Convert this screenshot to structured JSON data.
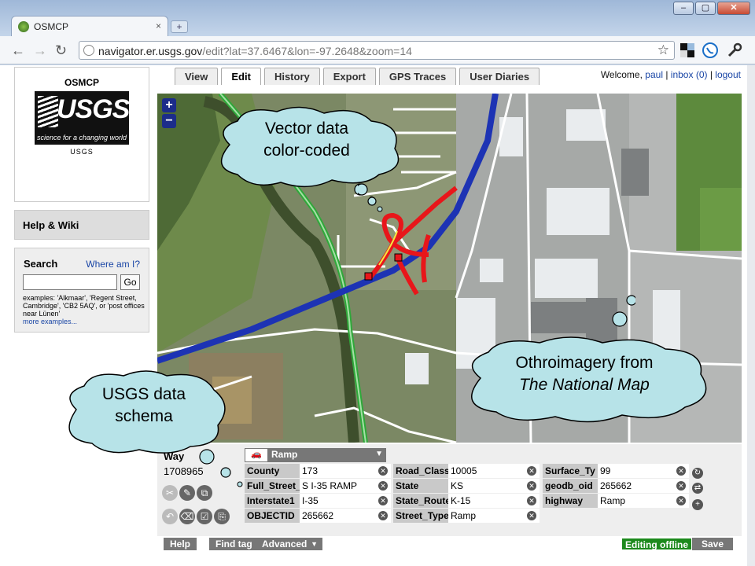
{
  "browser": {
    "tab_title": "OSMCP",
    "tab_close": "×",
    "new_tab": "+",
    "url_host": "navigator.er.usgs.gov",
    "url_path": "/edit?lat=37.6467&lon=-97.2648&zoom=14",
    "back": "←",
    "forward": "→",
    "reload": "↻",
    "star": "☆",
    "window_buttons": [
      "–",
      "▢",
      "✕"
    ]
  },
  "sidebar": {
    "site_name": "OSMCP",
    "logo_text": "USGS",
    "logo_tagline": "science for a changing world",
    "logo_caption": "USGS",
    "help_label": "Help & Wiki",
    "search_label": "Search",
    "where_label": "Where am I?",
    "search_value": "",
    "go_label": "Go",
    "examples_text": "examples: 'Alkmaar', 'Regent Street, Cambridge', 'CB2 5AQ', or 'post offices near Lünen'",
    "more_examples": "more examples..."
  },
  "nav_tabs": [
    "View",
    "Edit",
    "History",
    "Export",
    "GPS Traces",
    "User Diaries"
  ],
  "active_tab": "Edit",
  "header": {
    "welcome": "Welcome,",
    "inbox": "inbox (0)",
    "sep": "|",
    "logout": "logout"
  },
  "map": {
    "zoom_in": "+",
    "zoom_out": "−"
  },
  "callouts": {
    "vector": [
      "Vector data",
      "color-coded"
    ],
    "ortho": [
      "Othroimagery from",
      "The National Map"
    ],
    "schema": [
      "USGS data",
      "schema"
    ]
  },
  "editor": {
    "feature_type": "Way",
    "feature_id": "1708965",
    "preset": "Ramp",
    "preset_icon": "car-icon",
    "tag_columns": [
      [
        {
          "key": "County",
          "value": "173"
        },
        {
          "key": "Full_Street_",
          "value": "S I-35 RAMP"
        },
        {
          "key": "Interstate1",
          "value": "I-35"
        },
        {
          "key": "OBJECTID",
          "value": "265662"
        }
      ],
      [
        {
          "key": "Road_Class",
          "value": "10005"
        },
        {
          "key": "State",
          "value": "KS"
        },
        {
          "key": "State_Route",
          "value": "K-15"
        },
        {
          "key": "Street_Type",
          "value": "Ramp"
        }
      ],
      [
        {
          "key": "Surface_Ty",
          "value": "99"
        },
        {
          "key": "geodb_oid",
          "value": "265662"
        },
        {
          "key": "highway",
          "value": "Ramp"
        }
      ]
    ],
    "help_label": "Help",
    "findtag_label": "Find tag",
    "advanced_label": "Advanced",
    "advanced_arrow": "▼",
    "status": "Editing offline",
    "save_label": "Save"
  },
  "colors": {
    "motorway": "#1d33b4",
    "ramp": "#e8161a",
    "trunk": "#2fa83a",
    "link": "#1a46a6",
    "status_green": "#1d8a1d"
  }
}
